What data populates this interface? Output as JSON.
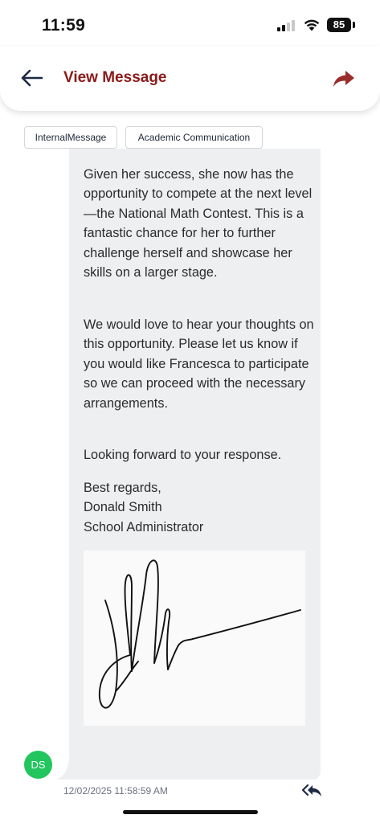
{
  "status_bar": {
    "time": "11:59",
    "battery": "85",
    "icons": [
      "signal-icon",
      "wifi-icon",
      "battery-icon"
    ]
  },
  "header": {
    "title": "View Message",
    "back_icon": "arrow-left-icon",
    "forward_icon": "forward-arrow-icon",
    "title_color": "#8b1a1a",
    "forward_color": "#9b2c2c"
  },
  "tags": [
    "InternalMessage",
    "Academic Communication"
  ],
  "message": {
    "paragraphs": [
      "Given her success, she now has the opportunity to compete at the next level—the National Math Contest. This is a fantastic chance for her to further challenge herself and showcase her skills on a larger stage.",
      "We would love to hear your thoughts on this opportunity. Please let us know if you would like Francesca to participate so we can proceed with the necessary arrangements.",
      "Looking forward to your response."
    ],
    "closing": "Best regards,",
    "sender_name": "Donald Smith",
    "sender_title": "School Administrator",
    "signature": "handwritten-signature-image",
    "bubble_color": "#eeeff1"
  },
  "sender": {
    "initials": "DS",
    "avatar_color": "#22c55e"
  },
  "meta": {
    "timestamp": "12/02/2025 11:58:59 AM",
    "reply_all_icon": "reply-all-icon"
  }
}
